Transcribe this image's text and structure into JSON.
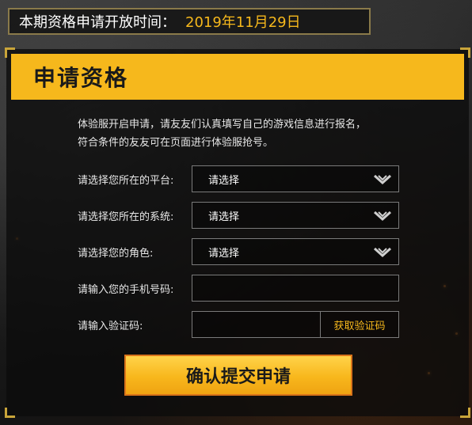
{
  "topbar": {
    "label": "本期资格申请开放时间：",
    "date": "2019年11月29日"
  },
  "panel": {
    "title": "申请资格",
    "intro_line1": "体验服开启申请，请友友们认真填写自己的游戏信息进行报名，",
    "intro_line2": "符合条件的友友可在页面进行体验服抢号。"
  },
  "form": {
    "platform": {
      "label": "请选择您所在的平台:",
      "value": "请选择"
    },
    "system": {
      "label": "请选择您所在的系统:",
      "value": "请选择"
    },
    "role": {
      "label": "请选择您的角色:",
      "value": "请选择"
    },
    "phone": {
      "label": "请输入您的手机号码:",
      "value": ""
    },
    "code": {
      "label": "请输入验证码:",
      "value": "",
      "button": "获取验证码"
    },
    "submit": "确认提交申请"
  },
  "colors": {
    "accent": "#f6b81c",
    "date_text": "#f6b81c",
    "submit_border": "#d9731a"
  },
  "icons": {
    "select_arrow": "chevron-down-icon"
  }
}
